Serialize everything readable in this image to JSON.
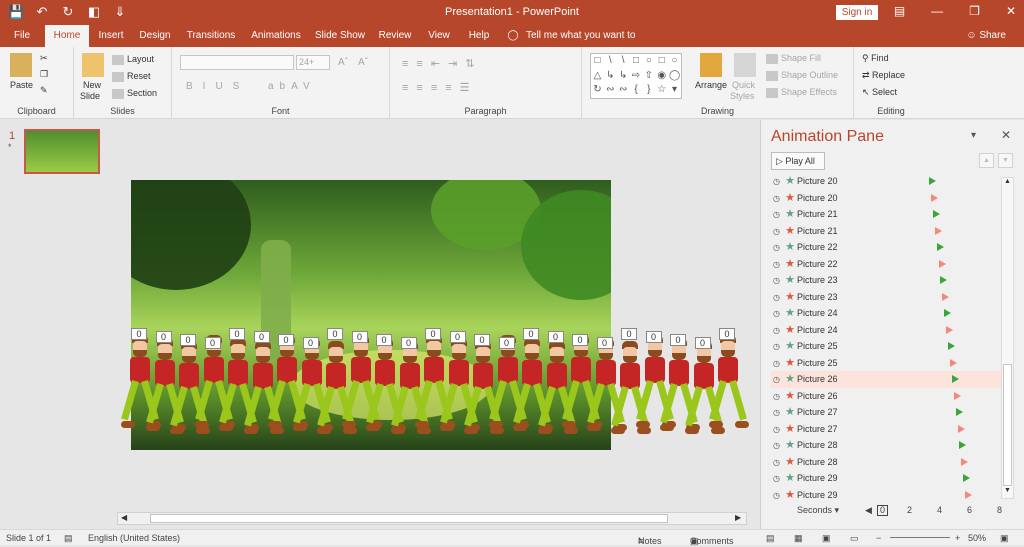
{
  "window": {
    "title": "Presentation1  -  PowerPoint",
    "signin": "Sign in"
  },
  "tabs": [
    "File",
    "Home",
    "Insert",
    "Design",
    "Transitions",
    "Animations",
    "Slide Show",
    "Review",
    "View",
    "Help"
  ],
  "active_tab": "Home",
  "tellme": "Tell me what you want to do",
  "share": "Share",
  "ribbon": {
    "clipboard": {
      "label": "Clipboard",
      "paste": "Paste"
    },
    "slides": {
      "label": "Slides",
      "new_slide": "New",
      "new_slide2": "Slide",
      "layout": "Layout",
      "reset": "Reset",
      "section": "Section"
    },
    "font": {
      "label": "Font",
      "size": "24+"
    },
    "paragraph": {
      "label": "Paragraph"
    },
    "drawing": {
      "label": "Drawing",
      "arrange": "Arrange",
      "quick_styles": "Quick",
      "quick_styles2": "Styles",
      "shape_fill": "Shape Fill",
      "shape_outline": "Shape Outline",
      "shape_effects": "Shape Effects"
    },
    "editing": {
      "label": "Editing",
      "find": "Find",
      "replace": "Replace",
      "select": "Select"
    }
  },
  "thumbnail": {
    "number": "1",
    "star": "*"
  },
  "slide_tags": [
    "0",
    "0",
    "0",
    "0",
    "0",
    "0",
    "0",
    "0",
    "0",
    "0",
    "0",
    "0",
    "0",
    "0",
    "0",
    "0",
    "0",
    "0",
    "0",
    "0",
    "0",
    "0",
    "0",
    "0",
    "0"
  ],
  "animation_pane": {
    "title": "Animation Pane",
    "play_all": "Play All",
    "seconds": "Seconds",
    "timeline": [
      "0",
      "2",
      "4",
      "6",
      "8"
    ],
    "items": [
      {
        "name": "Picture 20",
        "type": "entrance"
      },
      {
        "name": "Picture 20",
        "type": "exit"
      },
      {
        "name": "Picture 21",
        "type": "entrance"
      },
      {
        "name": "Picture 21",
        "type": "exit"
      },
      {
        "name": "Picture 22",
        "type": "entrance"
      },
      {
        "name": "Picture 22",
        "type": "exit"
      },
      {
        "name": "Picture 23",
        "type": "entrance"
      },
      {
        "name": "Picture 23",
        "type": "exit"
      },
      {
        "name": "Picture 24",
        "type": "entrance"
      },
      {
        "name": "Picture 24",
        "type": "exit"
      },
      {
        "name": "Picture 25",
        "type": "entrance"
      },
      {
        "name": "Picture 25",
        "type": "exit"
      },
      {
        "name": "Picture 26",
        "type": "entrance",
        "selected": true
      },
      {
        "name": "Picture 26",
        "type": "exit"
      },
      {
        "name": "Picture 27",
        "type": "entrance"
      },
      {
        "name": "Picture 27",
        "type": "exit"
      },
      {
        "name": "Picture 28",
        "type": "entrance"
      },
      {
        "name": "Picture 28",
        "type": "exit"
      },
      {
        "name": "Picture 29",
        "type": "entrance"
      },
      {
        "name": "Picture 29",
        "type": "exit"
      }
    ]
  },
  "status": {
    "slide": "Slide 1 of 1",
    "language": "English (United States)",
    "notes": "Notes",
    "comments": "Comments",
    "zoom": "50%"
  },
  "colors": {
    "accent": "#b7472a",
    "entrance": "#5fa37f",
    "exit": "#e0573d"
  }
}
